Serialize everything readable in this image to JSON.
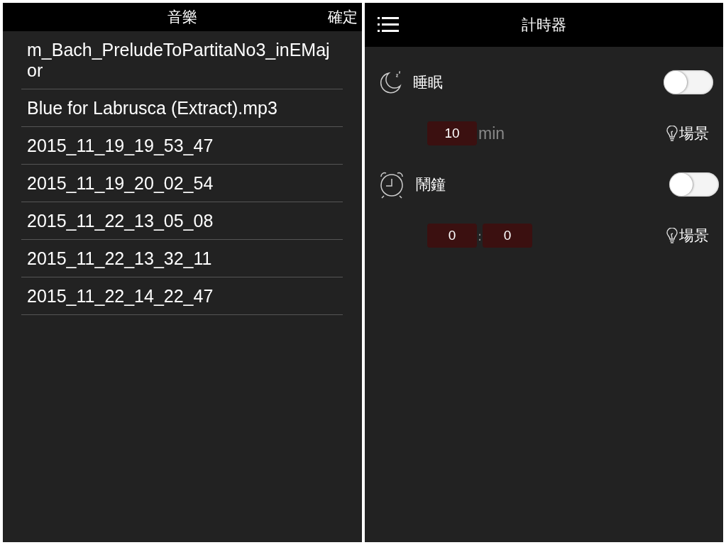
{
  "music_panel": {
    "title": "音樂",
    "confirm": "確定",
    "files": [
      {
        "name": "m_Bach_PreludeToPartitaNo3_inEMajor"
      },
      {
        "name": "Blue for Labrusca (Extract).mp3"
      },
      {
        "name": "2015_11_19_19_53_47"
      },
      {
        "name": "2015_11_19_20_02_54"
      },
      {
        "name": "2015_11_22_13_05_08"
      },
      {
        "name": "2015_11_22_13_32_11"
      },
      {
        "name": "2015_11_22_14_22_47"
      }
    ]
  },
  "timer_panel": {
    "title": "計時器",
    "timers": [
      {
        "kind": "sleep",
        "label": "睡眠",
        "on": false,
        "minutes": "10",
        "unit": "min",
        "scene": "場景"
      },
      {
        "kind": "alarm",
        "label": "鬧鐘",
        "on": false,
        "hour": "0",
        "separator": ":",
        "minute": "0",
        "scene": "場景"
      }
    ]
  }
}
